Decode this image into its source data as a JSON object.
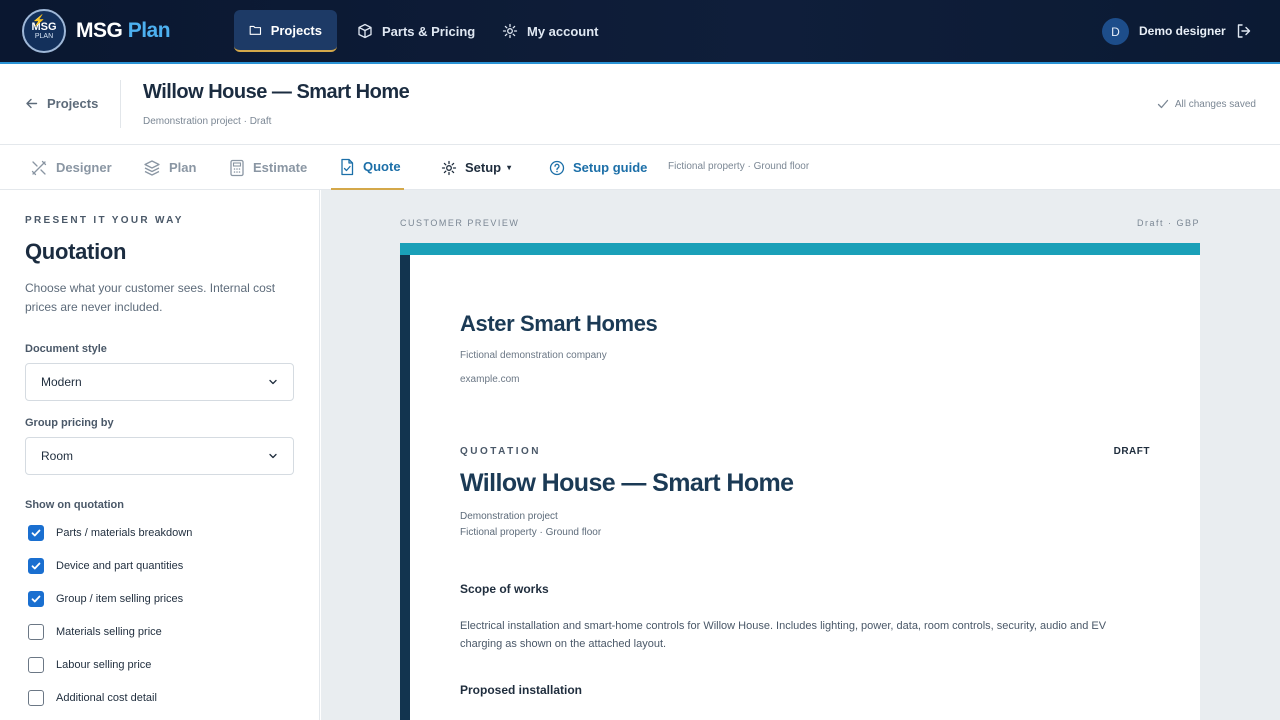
{
  "brand": {
    "logo_line1": "MSG",
    "logo_line2": "PLAN",
    "name_part1": "MSG",
    "name_part2": "Plan"
  },
  "topnav": {
    "items": [
      {
        "label": "Projects",
        "icon": "folder-icon",
        "active": true
      },
      {
        "label": "Parts & Pricing",
        "icon": "box-icon",
        "active": false
      },
      {
        "label": "My account",
        "icon": "gear-icon",
        "active": false
      }
    ],
    "user_initial": "D",
    "user_name": "Demo designer"
  },
  "header": {
    "back_label": "Projects",
    "title": "Willow House — Smart Home",
    "subtitle": "Demonstration project · Draft",
    "save_status": "All changes saved"
  },
  "subtabs": {
    "items": [
      {
        "label": "Designer",
        "icon": "designer-icon"
      },
      {
        "label": "Plan",
        "icon": "layers-icon"
      },
      {
        "label": "Estimate",
        "icon": "calculator-icon"
      },
      {
        "label": "Quote",
        "icon": "document-check-icon",
        "active": true
      },
      {
        "label": "Setup",
        "icon": "gear-icon",
        "caret": "▾"
      },
      {
        "label": "Setup guide",
        "icon": "help-circle-icon"
      }
    ],
    "context": "Fictional property · Ground floor"
  },
  "panel": {
    "eyebrow": "PRESENT IT YOUR WAY",
    "title": "Quotation",
    "description": "Choose what your customer sees. Internal cost prices are never included.",
    "document_style_label": "Document style",
    "document_style_value": "Modern",
    "group_pricing_label": "Group pricing by",
    "group_pricing_value": "Room",
    "show_label": "Show on quotation",
    "options": [
      {
        "label": "Parts / materials breakdown",
        "checked": true
      },
      {
        "label": "Device and part quantities",
        "checked": true
      },
      {
        "label": "Group / item selling prices",
        "checked": true
      },
      {
        "label": "Materials selling price",
        "checked": false
      },
      {
        "label": "Labour selling price",
        "checked": false
      },
      {
        "label": "Additional cost detail",
        "checked": false
      }
    ]
  },
  "preview": {
    "label": "CUSTOMER PREVIEW",
    "meta": "Draft · GBP",
    "company_name": "Aster Smart Homes",
    "company_tagline": "Fictional demonstration company",
    "company_website": "example.com",
    "doc_eyebrow": "QUOTATION",
    "doc_status": "DRAFT",
    "doc_title": "Willow House — Smart Home",
    "doc_sub1": "Demonstration project",
    "doc_sub2": "Fictional property · Ground floor",
    "scope_heading": "Scope of works",
    "scope_body": "Electrical installation and smart-home controls for Willow House. Includes lighting, power, data, room controls, security, audio and EV charging as shown on the attached layout.",
    "proposed_heading": "Proposed installation"
  },
  "colors": {
    "nav_bg": "#0f1e3a",
    "accent_blue": "#1c6fa8",
    "accent_gold": "#d4a84a",
    "doc_teal": "#1aa0b8",
    "doc_navy": "#12344f",
    "checkbox_blue": "#1a6fd0"
  }
}
